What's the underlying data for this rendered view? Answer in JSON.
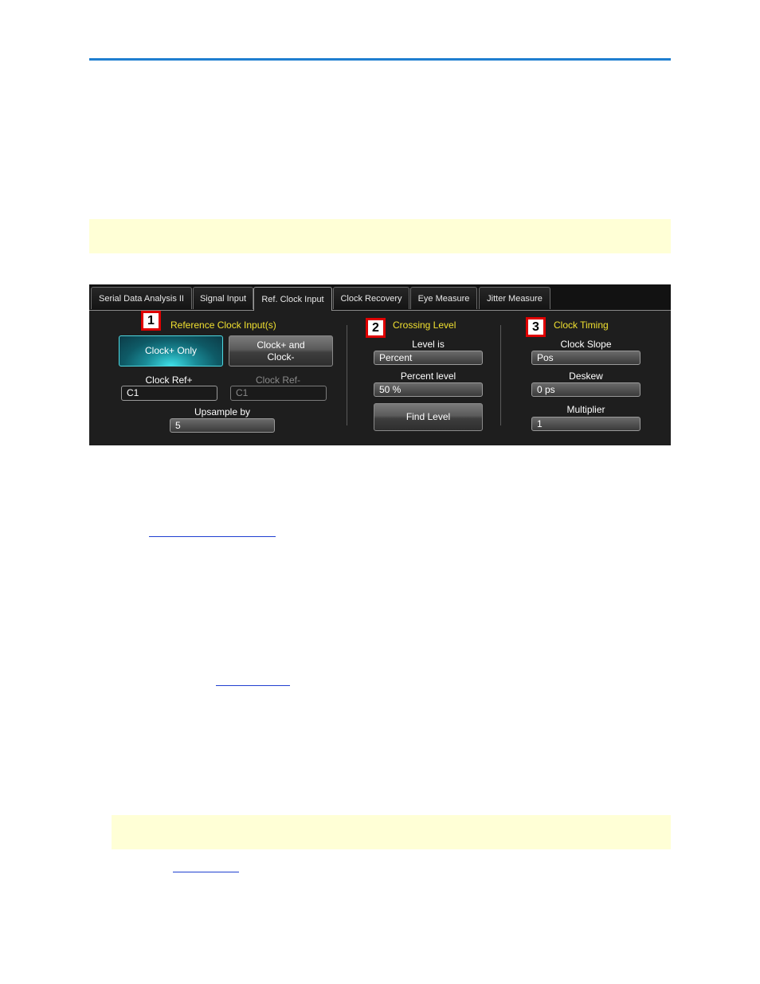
{
  "tabs": [
    {
      "label": "Serial Data Analysis II"
    },
    {
      "label": "Signal Input"
    },
    {
      "label": "Ref. Clock Input"
    },
    {
      "label": "Clock Recovery"
    },
    {
      "label": "Eye Measure"
    },
    {
      "label": "Jitter Measure"
    }
  ],
  "active_tab": "Ref. Clock Input",
  "sections": {
    "reference": {
      "badge": "1",
      "title": "Reference Clock Input(s)",
      "btn_clock_only": "Clock+ Only",
      "btn_clock_both": "Clock+ and\nClock-",
      "clock_ref_plus_label": "Clock Ref+",
      "clock_ref_plus_value": "C1",
      "clock_ref_minus_label": "Clock Ref-",
      "clock_ref_minus_value": "C1",
      "upsample_label": "Upsample by",
      "upsample_value": "5"
    },
    "crossing": {
      "badge": "2",
      "title": "Crossing Level",
      "level_is_label": "Level is",
      "level_is_value": "Percent",
      "percent_level_label": "Percent level",
      "percent_level_value": "50 %",
      "find_level_button": "Find Level"
    },
    "timing": {
      "badge": "3",
      "title": "Clock Timing",
      "slope_label": "Clock Slope",
      "slope_value": "Pos",
      "deskew_label": "Deskew",
      "deskew_value": "0 ps",
      "multiplier_label": "Multiplier",
      "multiplier_value": "1"
    }
  },
  "colors": {
    "header_rule": "#1f7fd0",
    "note_background": "#ffffd6",
    "section_title": "#f0e030",
    "badge_border": "#e00000",
    "selected_button": "#1a8c98"
  }
}
